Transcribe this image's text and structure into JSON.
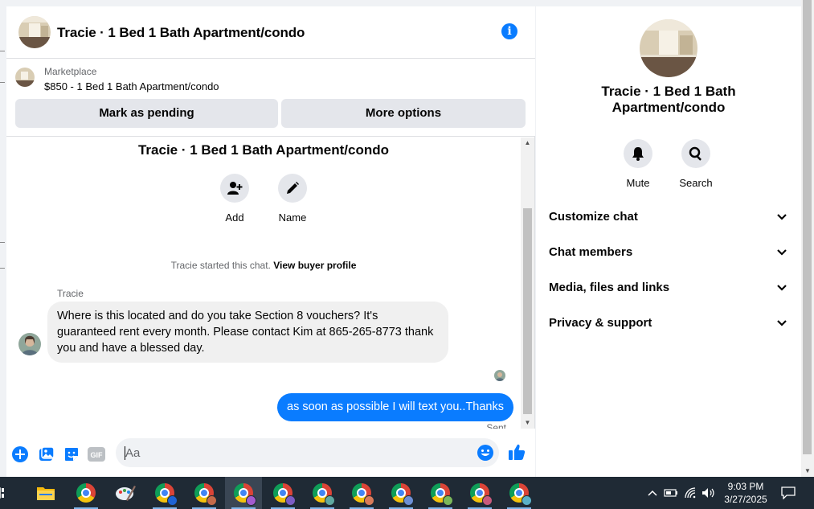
{
  "header": {
    "title": "Tracie · 1 Bed 1 Bath Apartment/condo"
  },
  "marketplace": {
    "label": "Marketplace",
    "listing": "$850 - 1 Bed 1 Bath Apartment/condo",
    "mark_pending": "Mark as pending",
    "more_options": "More options"
  },
  "conversation": {
    "title": "Tracie · 1 Bed 1 Bath Apartment/condo",
    "add_label": "Add",
    "name_label": "Name",
    "started_text": "Tracie started this chat.",
    "view_profile": "View buyer profile",
    "sender": "Tracie",
    "incoming": "Where is this located and do you take Section 8 vouchers? It's guaranteed rent every month. Please contact Kim at 865-265-8773 thank you and have a blessed day.",
    "outgoing": "as soon as possible I will text you..Thanks",
    "status": "Sent"
  },
  "composer": {
    "placeholder": "Aa",
    "gif_label": "GIF"
  },
  "info_panel": {
    "title": "Tracie · 1 Bed 1 Bath Apartment/condo",
    "mute_label": "Mute",
    "search_label": "Search",
    "sections": [
      "Customize chat",
      "Chat members",
      "Media, files and links",
      "Privacy & support"
    ]
  },
  "taskbar": {
    "time": "9:03 PM",
    "date": "3/27/2025"
  },
  "colors": {
    "accent": "#0a7cff",
    "bubble_in": "#f0f0f0",
    "taskbar": "#1f2a35"
  }
}
